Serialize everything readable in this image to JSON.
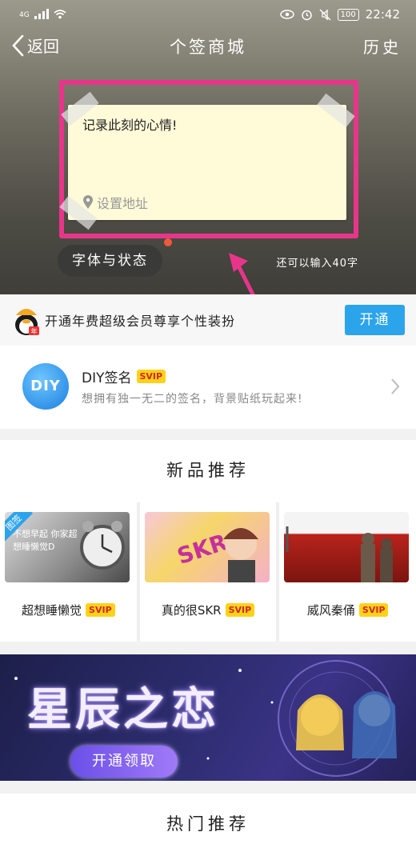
{
  "status_bar": {
    "network": "4G",
    "time": "22:42",
    "battery": "100"
  },
  "nav": {
    "back_label": "返回",
    "title": "个签商城",
    "history_label": "历史"
  },
  "editor": {
    "placeholder_text": "记录此刻的心情!",
    "location_label": "设置地址",
    "font_button": "字体与状态",
    "remaining": "还可以输入40字"
  },
  "promo": {
    "text": "开通年费超级会员尊享个性装扮",
    "button": "开通",
    "penguin_badge": "年"
  },
  "diy": {
    "logo_text": "DIY",
    "title": "DIY签名",
    "badge": "SVIP",
    "subtitle": "想拥有独一无二的签名，背景贴纸玩起来!"
  },
  "new_products": {
    "title": "新品推荐",
    "items": [
      {
        "name": "超想睡懒觉",
        "badge": "SVIP",
        "corner": "图签",
        "img_text": "不想早起 你家超想睡懒觉D"
      },
      {
        "name": "真的很SKR",
        "badge": "SVIP",
        "img_text": "SKR"
      },
      {
        "name": "威风秦俑",
        "badge": "SVIP"
      }
    ]
  },
  "banner": {
    "title": "星辰之恋",
    "button": "开通领取"
  },
  "hot": {
    "title": "热门推荐"
  },
  "colors": {
    "accent": "#2ba4ec",
    "highlight": "#e8358a",
    "badge_bg": "#ffd21a",
    "badge_text": "#d2281e"
  }
}
